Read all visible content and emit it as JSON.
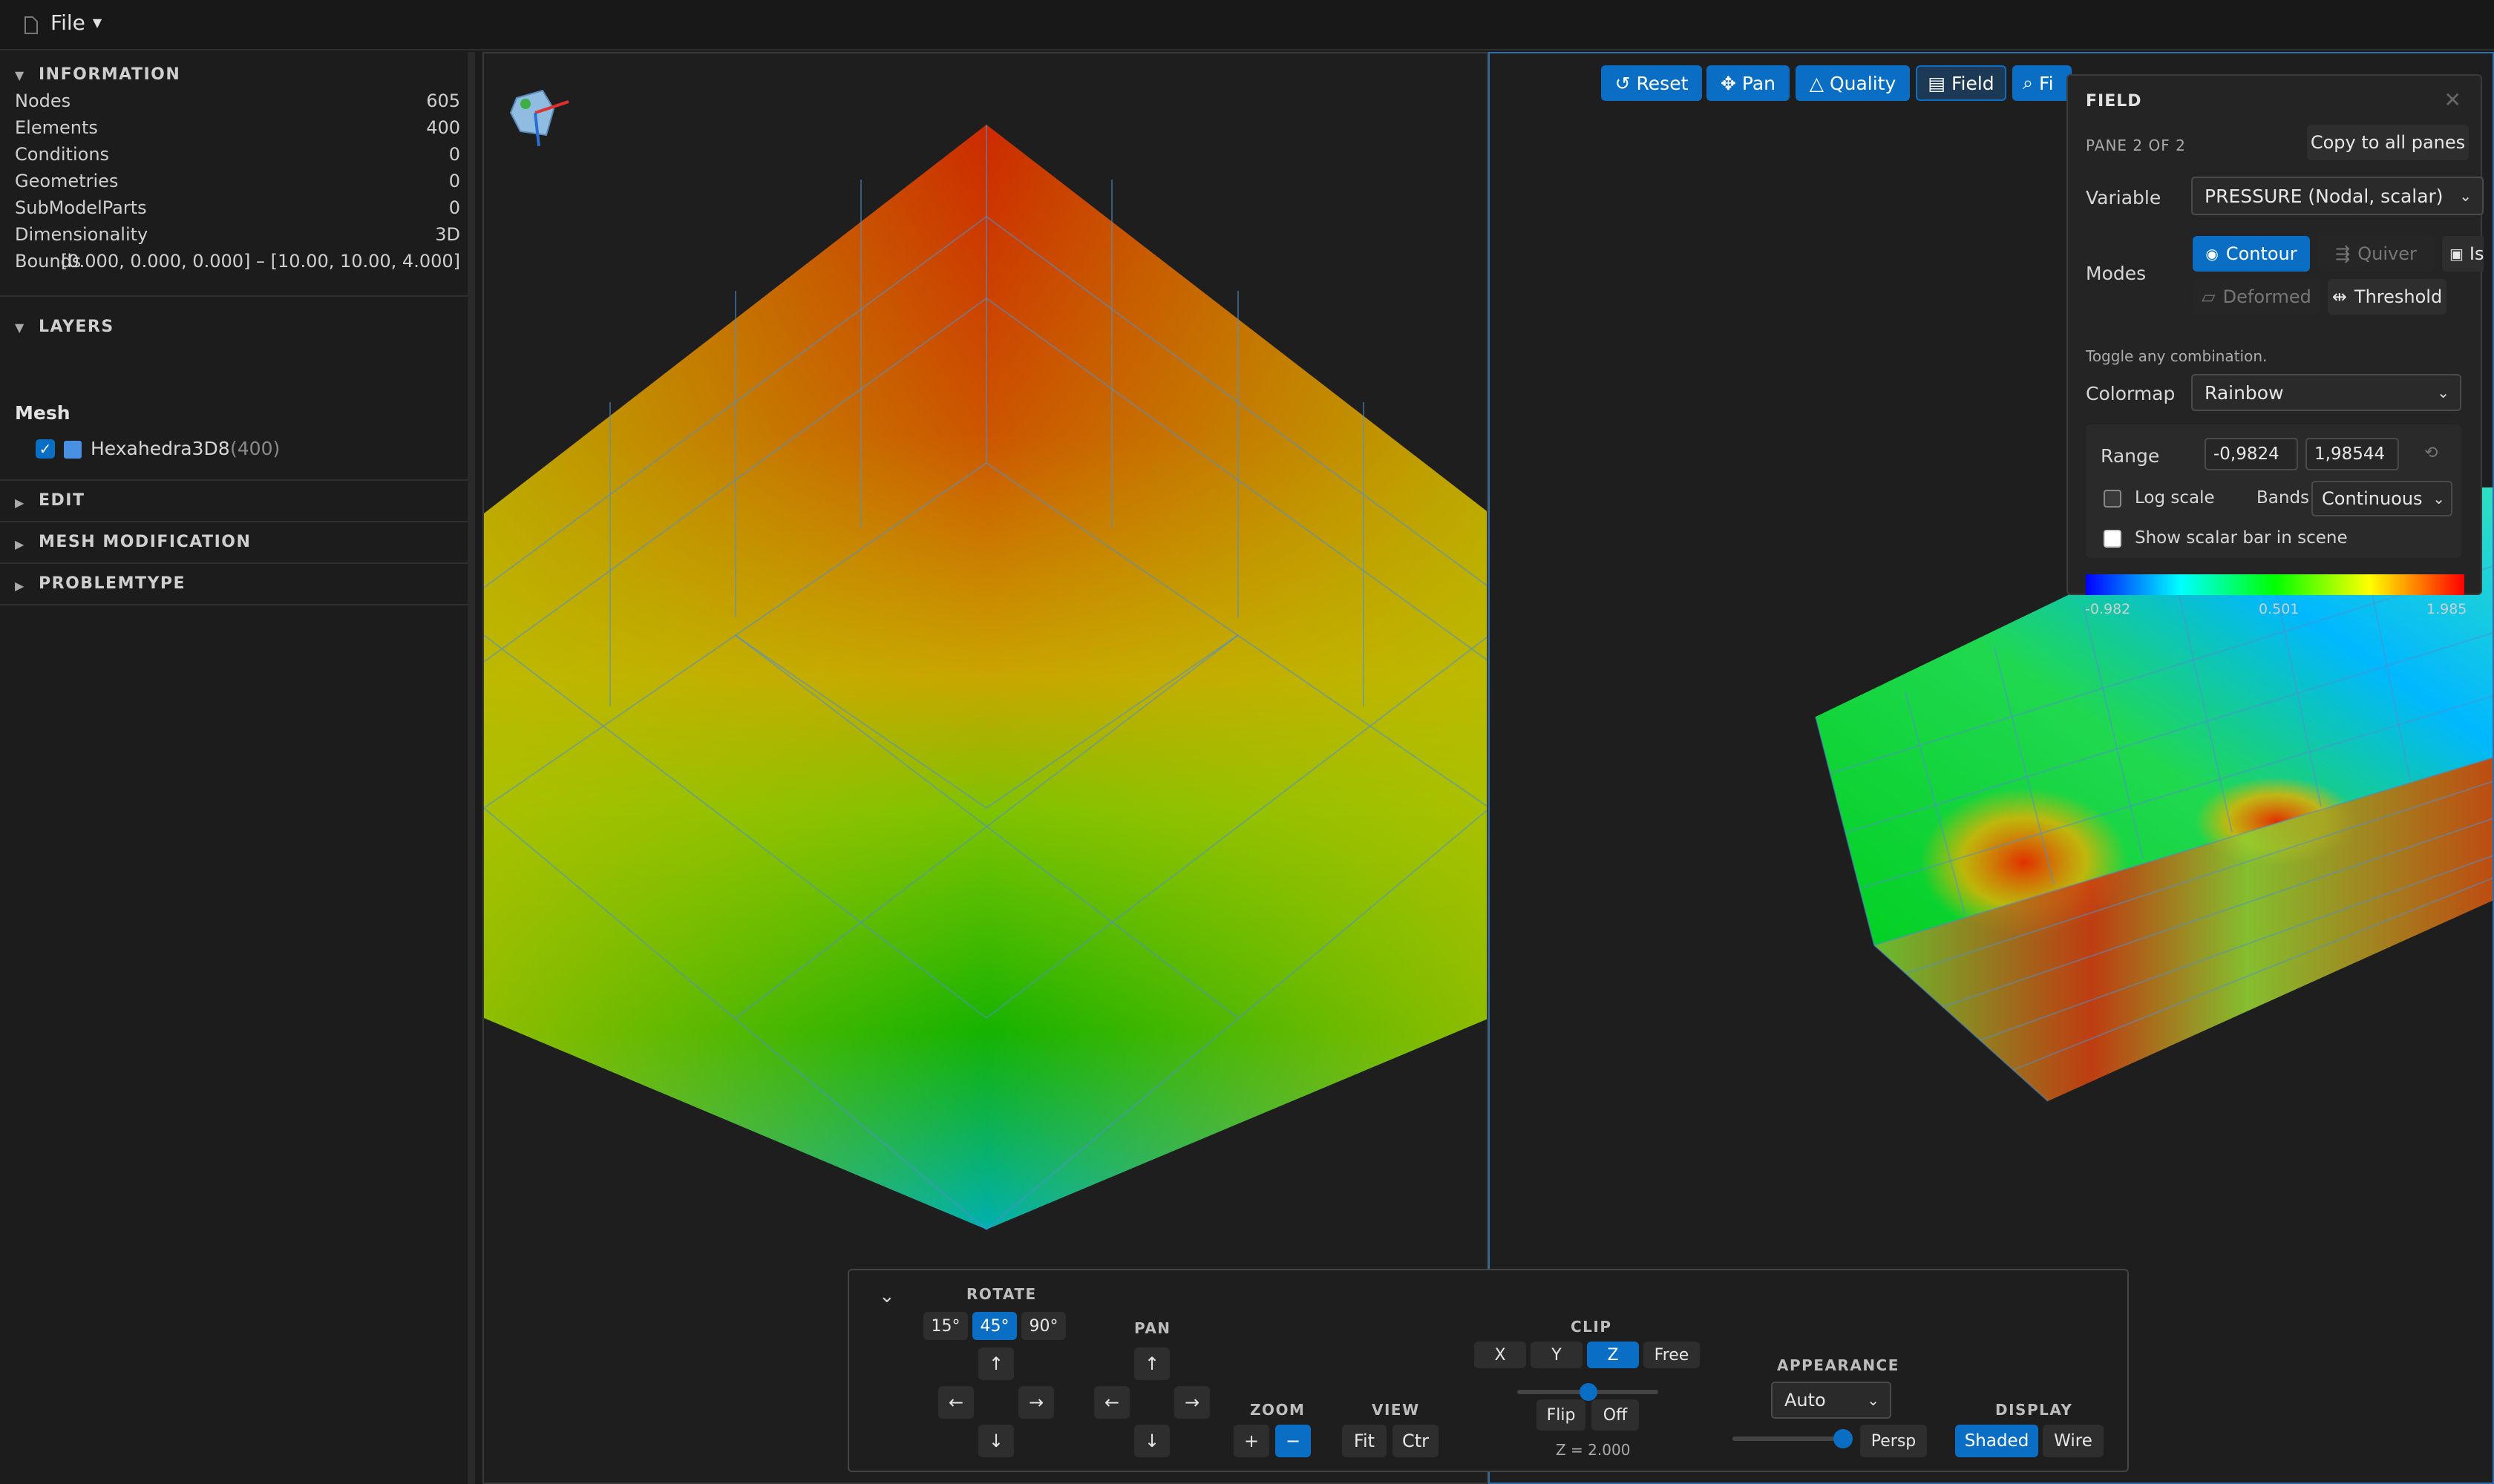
{
  "menu": {
    "file_label": "File"
  },
  "sidebar": {
    "information": {
      "title": "INFORMATION",
      "rows": [
        {
          "label": "Nodes",
          "value": "605"
        },
        {
          "label": "Elements",
          "value": "400"
        },
        {
          "label": "Conditions",
          "value": "0"
        },
        {
          "label": "Geometries",
          "value": "0"
        },
        {
          "label": "SubModelParts",
          "value": "0"
        },
        {
          "label": "Dimensionality",
          "value": "3D"
        },
        {
          "label": "Bounds",
          "value": "[0.000, 0.000, 0.000] – [10.00, 10.00, 4.000]"
        }
      ]
    },
    "layers": {
      "title": "LAYERS",
      "group": "Mesh",
      "item_label": "Hexahedra3D8",
      "item_count": "(400)",
      "item_color": "#4a90e2"
    },
    "edit": {
      "title": "EDIT"
    },
    "mesh_modification": {
      "title": "MESH MODIFICATION"
    },
    "problemtype": {
      "title": "PROBLEMTYPE"
    }
  },
  "toolbar": {
    "reset": "Reset",
    "pan": "Pan",
    "quality": "Quality",
    "field": "Field",
    "find": "Fi"
  },
  "field_panel": {
    "title": "FIELD",
    "pane": "PANE 2 OF 2",
    "copy_all": "Copy to all panes",
    "variable_label": "Variable",
    "variable_value": "PRESSURE (Nodal, scalar)",
    "modes_label": "Modes",
    "mode_contour": "Contour",
    "mode_quiver": "Quiver",
    "mode_iso": "Is",
    "mode_deformed": "Deformed",
    "mode_threshold": "Threshold",
    "hint": "Toggle any combination.",
    "colormap_label": "Colormap",
    "colormap_value": "Rainbow",
    "range_label": "Range",
    "range_min": "-0,9824",
    "range_max": "1,98544",
    "log_label": "Log scale",
    "bands_label": "Bands",
    "bands_value": "Continuous",
    "scalar_bar_label": "Show scalar bar in scene",
    "scale_min": "-0.982",
    "scale_mid": "0.501",
    "scale_max": "1.985"
  },
  "controls": {
    "rotate": {
      "title": "ROTATE",
      "steps": [
        "15°",
        "45°",
        "90°"
      ],
      "active_step": "45°"
    },
    "pan": {
      "title": "PAN"
    },
    "arrows": {
      "up": "↑",
      "down": "↓",
      "left": "←",
      "right": "→"
    },
    "zoom": {
      "title": "ZOOM",
      "in": "+",
      "out": "−"
    },
    "view": {
      "title": "VIEW",
      "fit": "Fit",
      "ctr": "Ctr"
    },
    "clip": {
      "title": "CLIP",
      "axes": [
        "X",
        "Y",
        "Z",
        "Free"
      ],
      "active_axis": "Z",
      "flip": "Flip",
      "off": "Off",
      "value": "Z = 2.000"
    },
    "appearance": {
      "title": "APPEARANCE",
      "select": "Auto",
      "persp": "Persp"
    },
    "display": {
      "title": "DISPLAY",
      "shaded": "Shaded",
      "wire": "Wire"
    }
  },
  "colors": {
    "accent": "#0a6fc4",
    "background": "#1e1e1e"
  }
}
